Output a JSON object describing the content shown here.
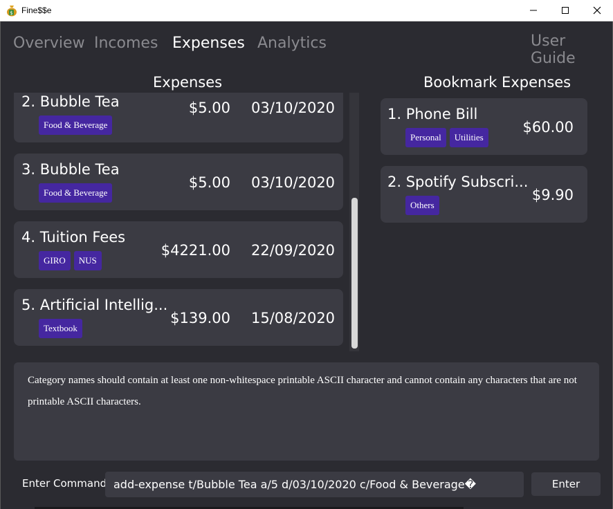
{
  "window": {
    "title": "Fine$$e",
    "icons": {
      "app": "money-bag-icon",
      "minimize": "minimize-icon",
      "maximize": "maximize-icon",
      "close": "close-icon"
    }
  },
  "tabs": {
    "overview": "Overview",
    "incomes": "Incomes",
    "expenses": "Expenses",
    "analytics": "Analytics",
    "active": "expenses"
  },
  "user_guide": "User Guide",
  "expenses_panel": {
    "title": "Expenses",
    "items": [
      {
        "name": "2. Bubble Tea",
        "amount": "$5.00",
        "date": "03/10/2020",
        "tags": [
          "Food & Beverage"
        ]
      },
      {
        "name": "3. Bubble Tea",
        "amount": "$5.00",
        "date": "03/10/2020",
        "tags": [
          "Food & Beverage"
        ]
      },
      {
        "name": "4. Tuition Fees",
        "amount": "$4221.00",
        "date": "22/09/2020",
        "tags": [
          "GIRO",
          "NUS"
        ]
      },
      {
        "name": "5. Artificial Intellig...",
        "amount": "$139.00",
        "date": "15/08/2020",
        "tags": [
          "Textbook"
        ]
      }
    ]
  },
  "bookmark_panel": {
    "title": "Bookmark Expenses",
    "items": [
      {
        "name": "1. Phone Bill",
        "amount": "$60.00",
        "tags": [
          "Personal",
          "Utilities"
        ]
      },
      {
        "name": "2. Spotify Subscri...",
        "amount": "$9.90",
        "tags": [
          "Others"
        ]
      }
    ]
  },
  "result_message": "Category names should contain at least one non-whitespace printable ASCII character and cannot contain any characters that are not printable ASCII characters.",
  "command": {
    "label": "Enter Command:",
    "value": "add-expense t/Bubble Tea a/5 d/03/10/2020 c/Food & Beverage�",
    "button": "Enter"
  },
  "colors": {
    "background": "#2b2b31",
    "card": "#3b3b43",
    "tag": "#4527a0",
    "active_tab": "#ffffff",
    "inactive_tab": "#8a8a8f"
  }
}
